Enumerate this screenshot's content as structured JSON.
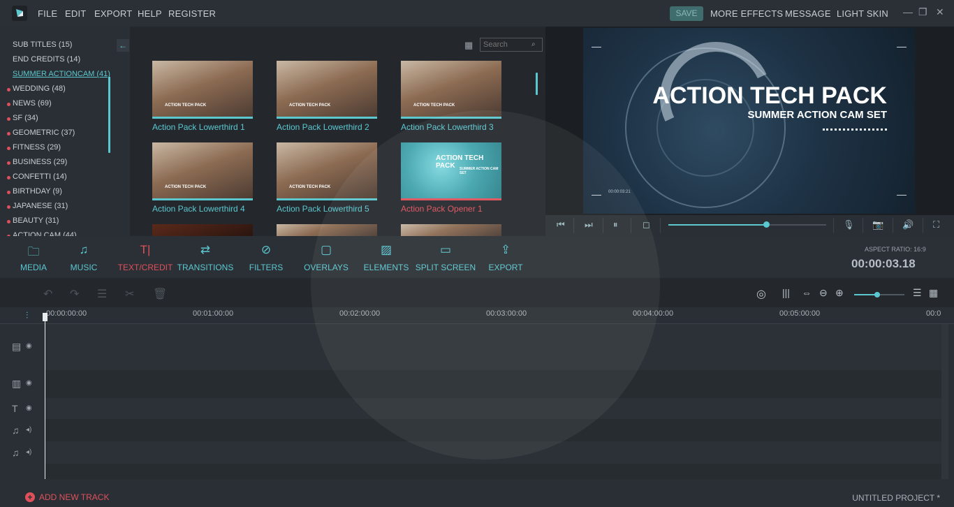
{
  "menu": {
    "items": [
      "FILE",
      "EDIT",
      "EXPORT",
      "HELP",
      "REGISTER"
    ],
    "save": "SAVE",
    "right": [
      "MORE EFFECTS",
      "MESSAGE",
      "LIGHT SKIN"
    ]
  },
  "categories": [
    {
      "label": "SUB TITLES (15)",
      "dot": false,
      "active": false
    },
    {
      "label": "END CREDITS (14)",
      "dot": false,
      "active": false
    },
    {
      "label": "SUMMER ACTIONCAM (41)",
      "dot": false,
      "active": true
    },
    {
      "label": "WEDDING (48)",
      "dot": true,
      "active": false
    },
    {
      "label": "NEWS (69)",
      "dot": true,
      "active": false
    },
    {
      "label": "SF (34)",
      "dot": true,
      "active": false
    },
    {
      "label": "GEOMETRIC (37)",
      "dot": true,
      "active": false
    },
    {
      "label": "FITNESS (29)",
      "dot": true,
      "active": false
    },
    {
      "label": "BUSINESS (29)",
      "dot": true,
      "active": false
    },
    {
      "label": "CONFETTI (14)",
      "dot": true,
      "active": false
    },
    {
      "label": "BIRTHDAY (9)",
      "dot": true,
      "active": false
    },
    {
      "label": "JAPANESE (31)",
      "dot": true,
      "active": false
    },
    {
      "label": "BEAUTY (31)",
      "dot": true,
      "active": false
    },
    {
      "label": "ACTION CAM (44)",
      "dot": true,
      "active": false
    }
  ],
  "library": {
    "search_placeholder": "Search",
    "thumbs": [
      {
        "label": "Action Pack Lowerthird 1",
        "overlay": "ACTION TECH PACK"
      },
      {
        "label": "Action Pack Lowerthird 2",
        "overlay": "ACTION TECH PACK"
      },
      {
        "label": "Action Pack Lowerthird 3",
        "overlay": "ACTION TECH PACK"
      },
      {
        "label": "Action Pack Lowerthird 4",
        "overlay": "ACTION TECH PACK"
      },
      {
        "label": "Action Pack Lowerthird 5",
        "overlay": "ACTION TECH PACK"
      },
      {
        "label": "Action Pack Opener 1",
        "overlay": "ACTION TECH PACK"
      }
    ],
    "opener_subtitle": "SUMMER ACTION CAM SET"
  },
  "preview": {
    "title": "ACTION TECH PACK",
    "subtitle": "SUMMER ACTION CAM SET",
    "timecode": "00:00:03:21",
    "progress": 0.62
  },
  "toolbar": {
    "items": [
      {
        "label": "MEDIA",
        "icon": "folder-icon"
      },
      {
        "label": "MUSIC",
        "icon": "music-icon"
      },
      {
        "label": "TEXT/CREDIT",
        "icon": "text-icon"
      },
      {
        "label": "TRANSITIONS",
        "icon": "transition-icon"
      },
      {
        "label": "FILTERS",
        "icon": "filter-icon"
      },
      {
        "label": "OVERLAYS",
        "icon": "overlay-icon"
      },
      {
        "label": "ELEMENTS",
        "icon": "image-icon"
      },
      {
        "label": "SPLIT SCREEN",
        "icon": "split-icon"
      },
      {
        "label": "EXPORT",
        "icon": "export-icon"
      }
    ],
    "aspect": "ASPECT RATIO: 16:9",
    "timecode": "00:00:03.18"
  },
  "ruler": [
    "00:00:00:00",
    "00:01:00:00",
    "00:02:00:00",
    "00:03:00:00",
    "00:04:00:00",
    "00:05:00:00",
    "00:0"
  ],
  "footer": {
    "add_track": "ADD NEW TRACK",
    "project": "UNTITLED PROJECT *"
  },
  "colors": {
    "accent": "#5bc8d0",
    "active": "#e0505a"
  }
}
